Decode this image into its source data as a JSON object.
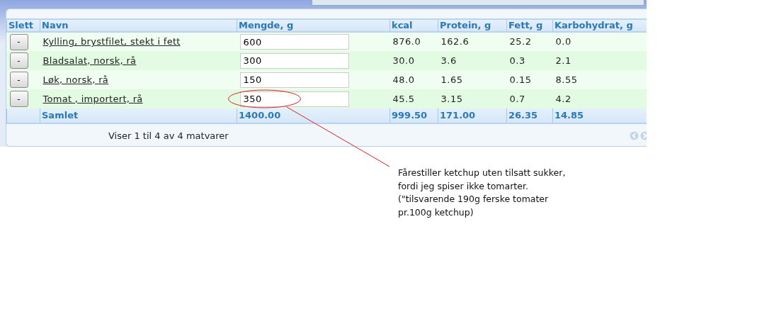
{
  "table": {
    "columns": [
      "Slett",
      "Navn",
      "Mengde, g",
      "kcal",
      "Protein, g",
      "Fett, g",
      "Karbohydrat, g"
    ],
    "rows": [
      {
        "delete_label": "-",
        "name": "Kylling, brystfilet, stekt i fett",
        "amount": "600",
        "kcal": "876.0",
        "protein": "162.6",
        "fat": "25.2",
        "carbs": "0.0",
        "highlighted": false
      },
      {
        "delete_label": "-",
        "name": "Bladsalat, norsk, rå",
        "amount": "300",
        "kcal": "30.0",
        "protein": "3.6",
        "fat": "0.3",
        "carbs": "2.1",
        "highlighted": false
      },
      {
        "delete_label": "-",
        "name": "Løk, norsk, rå",
        "amount": "150",
        "kcal": "48.0",
        "protein": "1.65",
        "fat": "0.15",
        "carbs": "8.55",
        "highlighted": false
      },
      {
        "delete_label": "-",
        "name": "Tomat , importert, rå",
        "amount": "350",
        "kcal": "45.5",
        "protein": "3.15",
        "fat": "0.7",
        "carbs": "4.2",
        "highlighted": true
      }
    ],
    "totals": {
      "label": "Samlet",
      "amount": "1400.00",
      "kcal": "999.50",
      "protein": "171.00",
      "fat": "26.35",
      "carbs": "14.85"
    },
    "footer": "Viser 1 til 4 av 4 matvarer"
  },
  "annotation": {
    "lines": [
      "Fårestiller ketchup uten tilsatt sukker,",
      "fordi jeg spiser ikke tomarter.",
      "(\"tilsvarende 190g ferske tomater",
      "pr.100g ketchup)"
    ]
  }
}
